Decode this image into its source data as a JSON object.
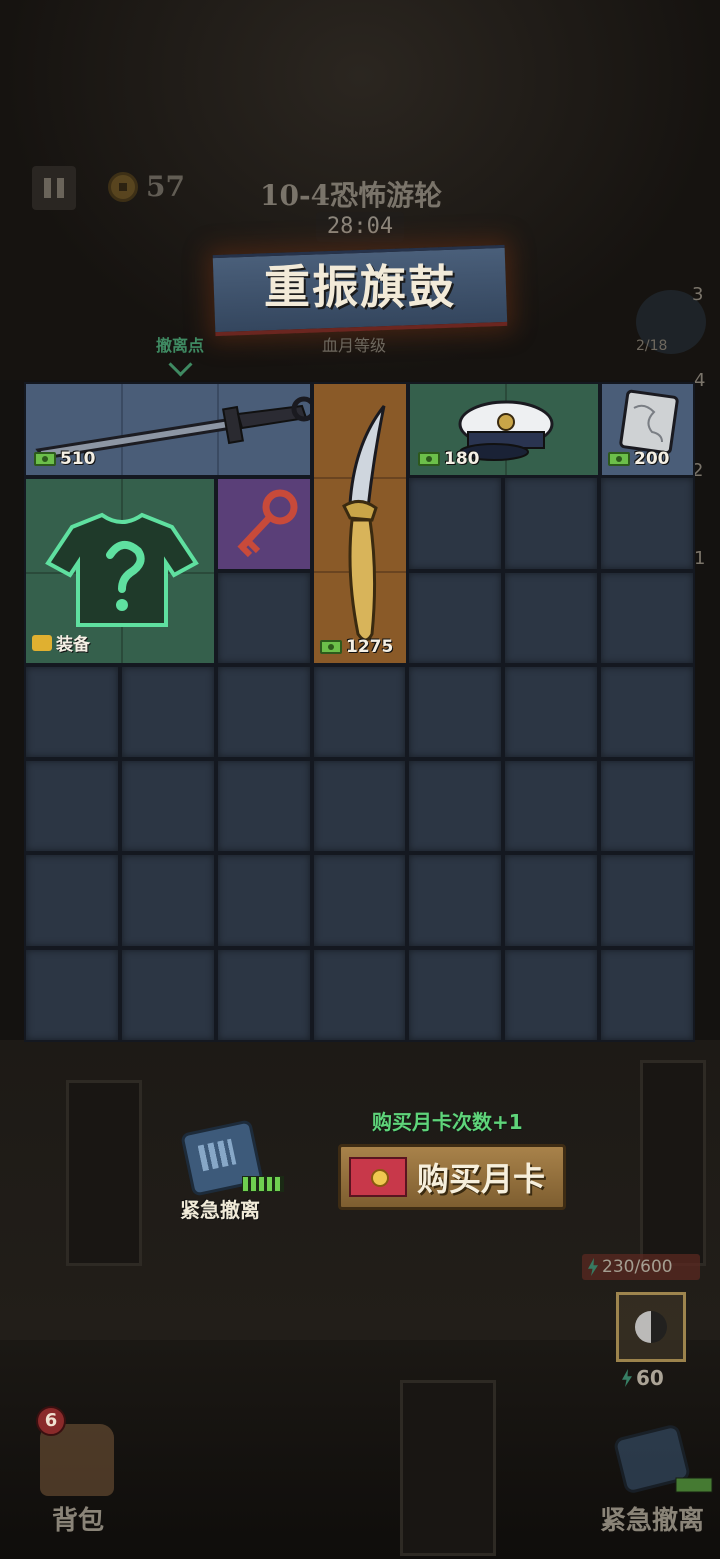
{
  "hud": {
    "coin_count": "57",
    "stage_title": "10-4恐怖游轮",
    "timer": "28:04",
    "banner_title": "重振旗鼓",
    "blood_moon_label": "血月等级",
    "evac_point_label": "撤离点",
    "side_numbers": [
      "3",
      "4",
      "2",
      "1"
    ],
    "weapon_count": "2/18"
  },
  "inventory": {
    "items": [
      {
        "name": "katana",
        "rarity": "blue",
        "price": "510"
      },
      {
        "name": "curved-dagger",
        "rarity": "orange",
        "price": "1275"
      },
      {
        "name": "captain-hat",
        "rarity": "green",
        "price": "180"
      },
      {
        "name": "silver-token",
        "rarity": "blue",
        "price": "200"
      },
      {
        "name": "mystery-shirt",
        "rarity": "green",
        "tag": "装备"
      },
      {
        "name": "red-key",
        "rarity": "purple"
      }
    ]
  },
  "actions": {
    "emergency_label": "紧急撤离",
    "promo_text": "购买月卡次数+1",
    "buy_label": "购买月卡",
    "stamina": "230/600",
    "skill_cost": "60",
    "backpack_badge": "6",
    "backpack_label": "背包",
    "emergency2_label": "紧急撤离"
  },
  "colors": {
    "rarity_blue": "#4a5d78",
    "rarity_green": "#35604c",
    "rarity_orange": "#8a5a28",
    "rarity_purple": "#5a3f78",
    "accent_green": "#5fd47a"
  }
}
